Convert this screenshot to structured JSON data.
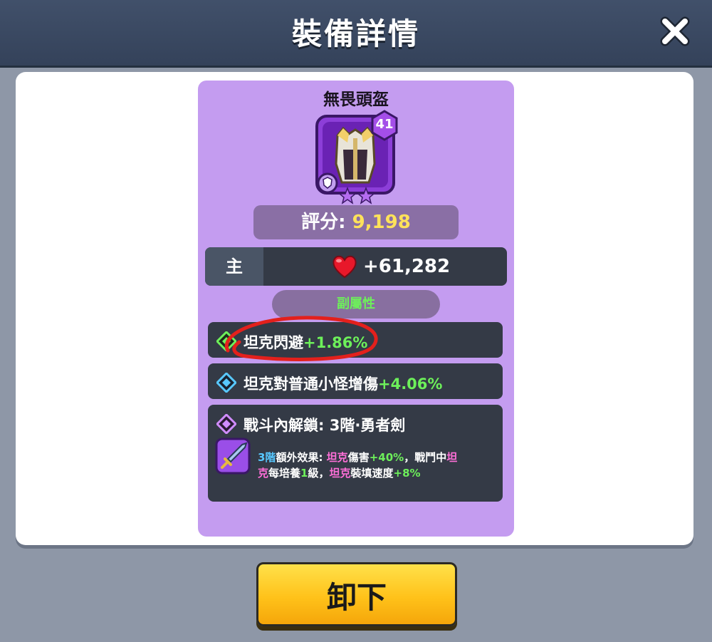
{
  "window": {
    "title": "裝備詳情"
  },
  "item": {
    "name": "無畏頭盔",
    "level": "41",
    "stars": 2,
    "score_label": "評分: ",
    "score_value": "9,198"
  },
  "main_stat": {
    "label": "主",
    "icon": "heart-icon",
    "value": "+61,282"
  },
  "sub_stats_header": "副屬性",
  "sub_stats": [
    {
      "name": "坦克閃避",
      "value": "+1.86%",
      "icon": "green-diamond-icon"
    },
    {
      "name": "坦克對普通小怪增傷",
      "value": "+4.06%",
      "icon": "blue-diamond-icon"
    }
  ],
  "unlock": {
    "title": "戰斗內解鎖: 3階·勇者劍",
    "tier": "3階",
    "extra_label": "額外效果:",
    "seg1": "坦克",
    "seg2": "傷害",
    "seg3": "+40%",
    "seg4": "，戰鬥中",
    "seg5": "坦",
    "seg6": "克",
    "seg7": "每培養",
    "seg8": "1",
    "seg9": "級，",
    "seg10": "坦克",
    "seg11": "裝填速度",
    "seg12": "+8%"
  },
  "unequip_button": "卸下",
  "colors": {
    "accent_green": "#6df05a",
    "accent_pink": "#ff6fd8",
    "score_yellow": "#ffe25a"
  }
}
